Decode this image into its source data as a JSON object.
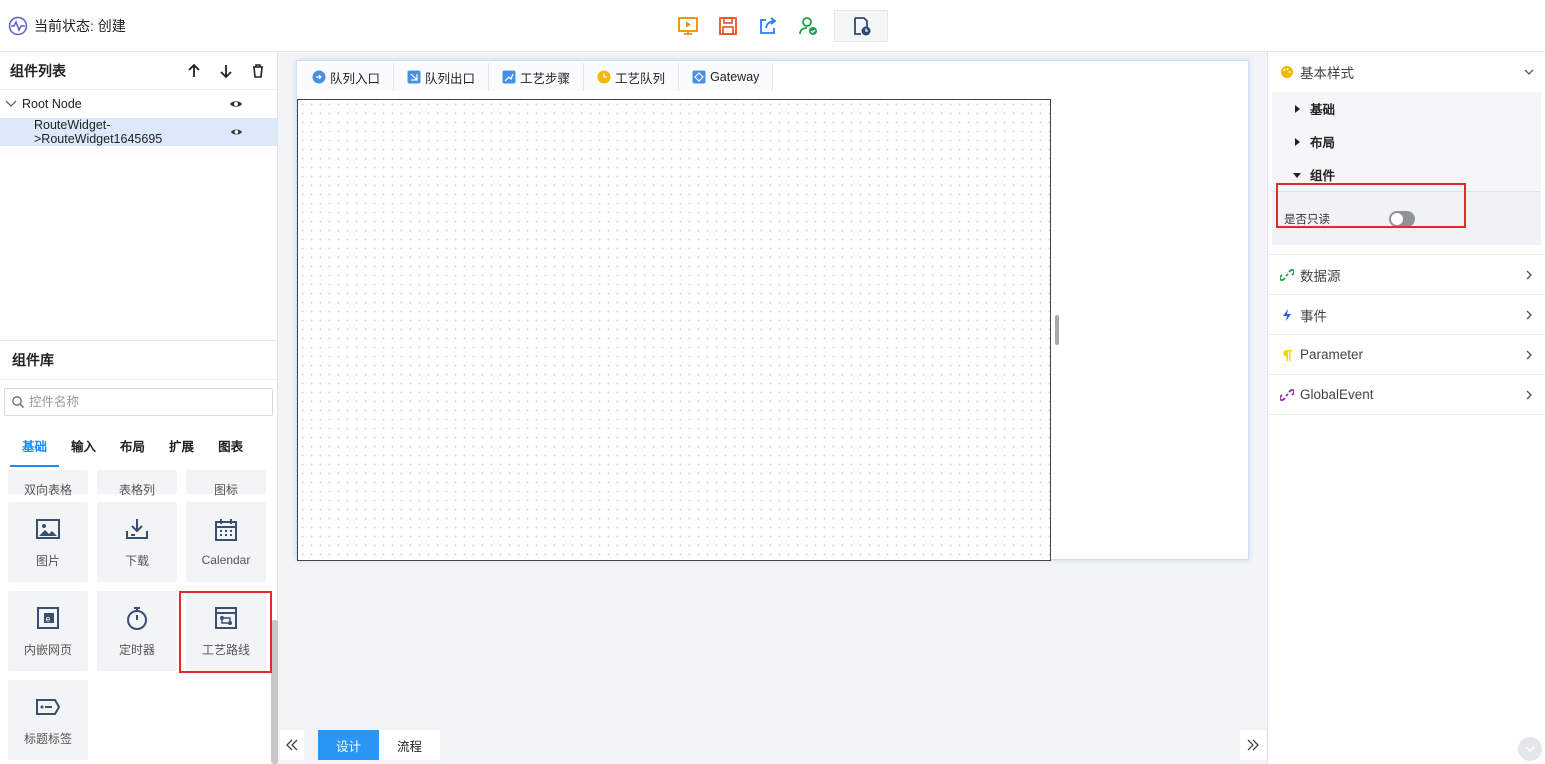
{
  "header": {
    "status_text": "当前状态: 创建",
    "tools": [
      "preview-icon",
      "save-icon",
      "export-icon",
      "publish-user-icon",
      "history-icon"
    ]
  },
  "component_list": {
    "title": "组件列表",
    "tree": [
      {
        "label": "Root Node"
      },
      {
        "label": "RouteWidget->RouteWidget1645695"
      }
    ]
  },
  "library": {
    "title": "组件库",
    "search_placeholder": "控件名称",
    "tabs": [
      "基础",
      "输入",
      "布局",
      "扩展",
      "图表"
    ],
    "active_tab": "基础",
    "partial_items": [
      "双向表格",
      "表格列",
      "图标"
    ],
    "items": [
      "图片",
      "下载",
      "Calendar",
      "内嵌网页",
      "定时器",
      "工艺路线",
      "标题标签"
    ]
  },
  "canvas_toolbar": [
    "队列入口",
    "队列出口",
    "工艺步骤",
    "工艺队列",
    "Gateway"
  ],
  "modes": {
    "design": "设计",
    "flow": "流程",
    "active": "设计"
  },
  "properties": {
    "basic_style": "基本样式",
    "sub_sections": [
      "基础",
      "布局",
      "组件"
    ],
    "readonly_label": "是否只读",
    "readonly_value": false,
    "sections": [
      "数据源",
      "事件",
      "Parameter",
      "GlobalEvent"
    ]
  },
  "colors": {
    "accent": "#2b95f4",
    "highlight": "#e52828",
    "selected_row": "#dbe9fb"
  }
}
